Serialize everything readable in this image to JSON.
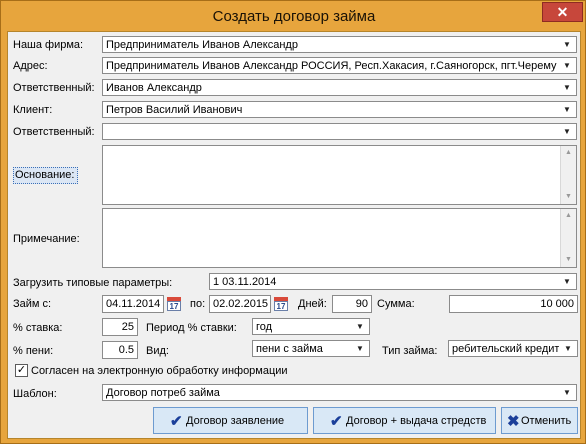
{
  "window": {
    "title": "Создать договор займа",
    "close": "✕"
  },
  "fields": {
    "firm": {
      "label": "Наша фирма:",
      "value": "Предприниматель Иванов Александр"
    },
    "address": {
      "label": "Адрес:",
      "value": "Предприниматель Иванов Александр РОССИЯ, Респ.Хакасия, г.Саяногорск, пгт.Черему"
    },
    "responsible1": {
      "label": "Ответственный:",
      "value": "Иванов Александр"
    },
    "client": {
      "label": "Клиент:",
      "value": "Петров Василий Иванович"
    },
    "responsible2": {
      "label": "Ответственный:",
      "value": ""
    },
    "basis": {
      "label": "Основание:",
      "value": ""
    },
    "note": {
      "label": "Примечание:",
      "value": ""
    },
    "template_params": {
      "label": "Загрузить типовые параметры:",
      "value": "1 03.11.2014"
    },
    "loan_from": {
      "label": "Займ с:",
      "value": "04.11.2014"
    },
    "loan_to": {
      "label": "по:",
      "value": "02.02.2015"
    },
    "days": {
      "label": "Дней:",
      "value": "90"
    },
    "sum": {
      "label": "Сумма:",
      "value": "10 000"
    },
    "rate": {
      "label": "% ставка:",
      "value": "25"
    },
    "rate_period": {
      "label": "Период % ставки:",
      "value": "год"
    },
    "penalty": {
      "label": "% пени:",
      "value": "0.5"
    },
    "kind": {
      "label": "Вид:",
      "value": "пени с займа"
    },
    "loan_type": {
      "label": "Тип займа:",
      "value": "ребительский кредит"
    },
    "consent": {
      "label": "Согласен на электронную обработку информации",
      "checked": true,
      "mark": "✓"
    },
    "template": {
      "label": "Шаблон:",
      "value": "Договор потреб займа"
    }
  },
  "calendar_day": "17",
  "buttons": {
    "contract_application": "Договор заявление",
    "contract_issue": "Договор + выдача стредств",
    "cancel": "Отменить"
  },
  "icons": {
    "check": "✔",
    "cancel": "✖",
    "dropdown": "▼",
    "scroll_up": "▲",
    "scroll_down": "▼"
  }
}
